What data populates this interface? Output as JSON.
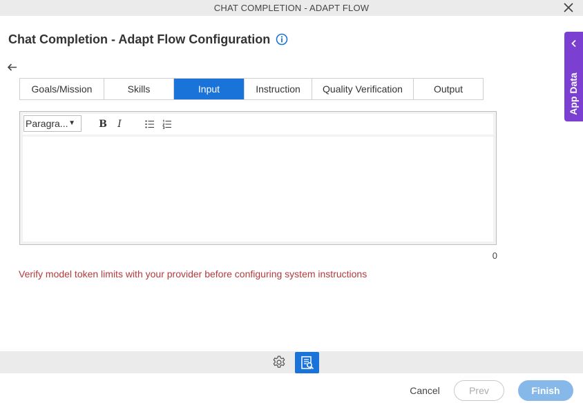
{
  "window": {
    "title": "CHAT COMPLETION - ADAPT FLOW",
    "close_icon": "close-icon"
  },
  "page": {
    "heading": "Chat Completion - Adapt Flow Configuration",
    "info_icon": "info-icon",
    "back_icon": "arrow-left-icon"
  },
  "tabs": [
    {
      "label": "Goals/Mission",
      "active": false
    },
    {
      "label": "Skills",
      "active": false
    },
    {
      "label": "Input",
      "active": true
    },
    {
      "label": "Instruction",
      "active": false
    },
    {
      "label": "Quality Verification",
      "active": false
    },
    {
      "label": "Output",
      "active": false
    }
  ],
  "editor": {
    "format_select": "Paragra...",
    "bold_label": "B",
    "italic_label": "I",
    "content": "",
    "char_count": "0"
  },
  "warning": "Verify model token limits with your provider before configuring system instructions",
  "side_panel": {
    "label": "App Data",
    "icon": "chevron-left-icon"
  },
  "footer": {
    "settings_icon": "gear-icon",
    "doc_icon": "document-search-icon",
    "cancel_label": "Cancel",
    "prev_label": "Prev",
    "finish_label": "Finish"
  },
  "colors": {
    "accent": "#1a73d9",
    "side_panel": "#7b3fd1",
    "warning": "#b33a3a",
    "finish_disabled": "#86b8ea"
  }
}
